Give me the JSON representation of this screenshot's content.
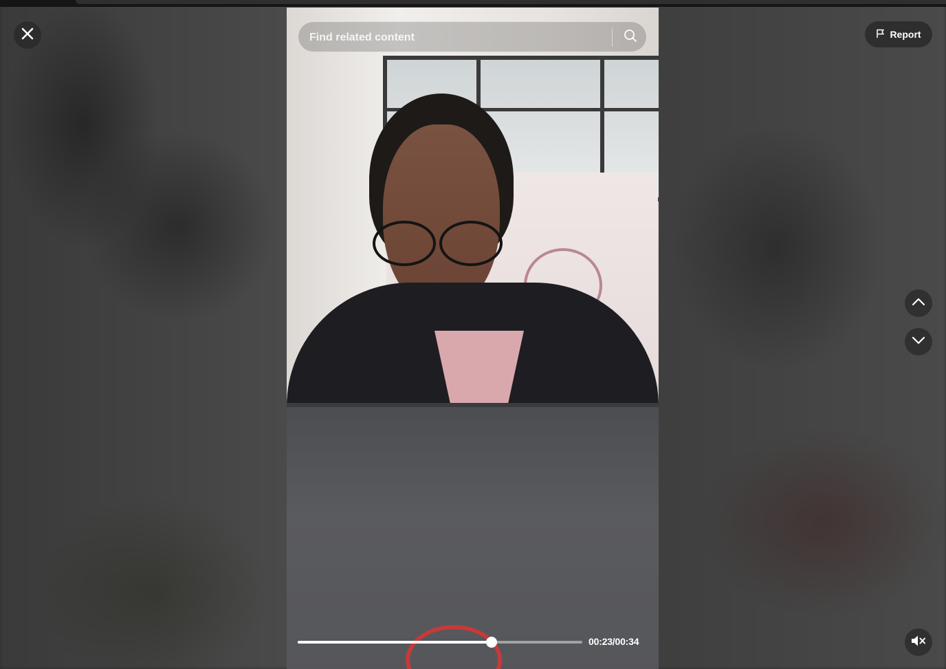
{
  "search": {
    "placeholder": "Find related content",
    "icon": "search-icon"
  },
  "controls": {
    "close_icon": "close-icon",
    "report_label": "Report",
    "report_icon": "flag-icon",
    "prev_icon": "chevron-up-icon",
    "next_icon": "chevron-down-icon",
    "mute_icon": "volume-muted-icon"
  },
  "player": {
    "current_time": "00:23",
    "total_time": "00:34",
    "time_display": "00:23/00:34",
    "progress_fraction": 0.68
  },
  "colors": {
    "overlay_button": "#282828",
    "progress_fill": "#ffffff",
    "text": "#ffffff"
  }
}
